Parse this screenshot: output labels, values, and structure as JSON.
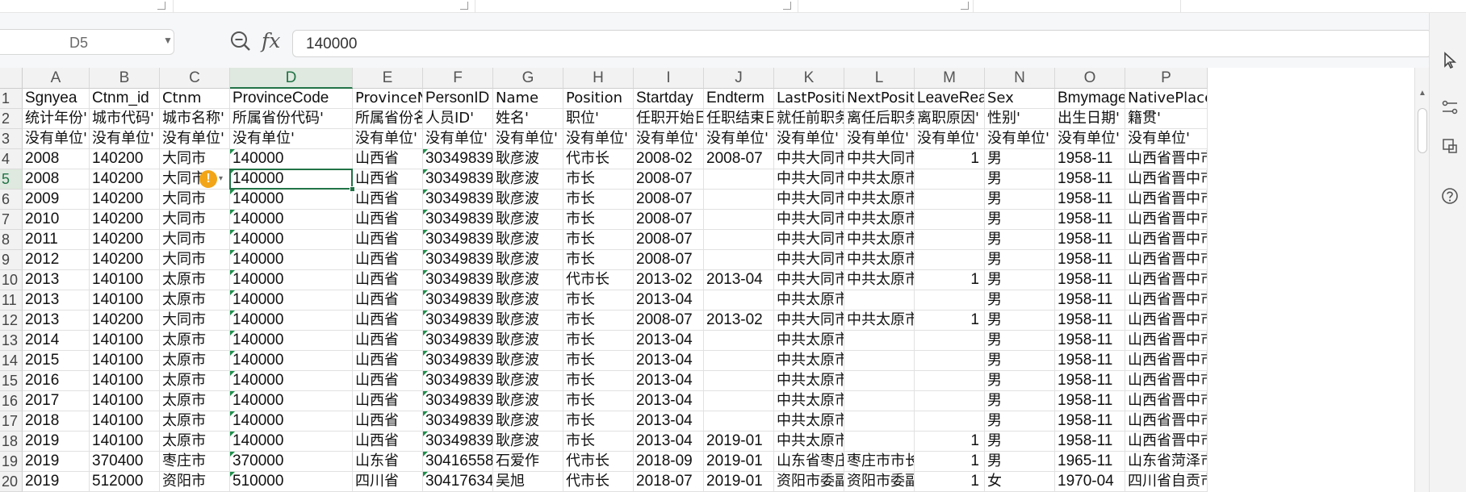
{
  "namebox": {
    "value": "D5"
  },
  "formula": {
    "value": "140000"
  },
  "columns": [
    "A",
    "B",
    "C",
    "D",
    "E",
    "F",
    "G",
    "H",
    "I",
    "J",
    "K",
    "L",
    "M",
    "N",
    "O",
    "P"
  ],
  "active_column": "D",
  "row_numbers": [
    "1",
    "2",
    "3",
    "4",
    "5",
    "6",
    "7",
    "8",
    "9",
    "10",
    "11",
    "12",
    "13",
    "14",
    "15",
    "16",
    "17",
    "18",
    "19",
    "20"
  ],
  "active_row": "5",
  "rows": [
    [
      "Sgnyea",
      "Ctnm_id",
      "Ctnm",
      "ProvinceCode",
      "ProvinceNa",
      "PersonID",
      "Name",
      "Position",
      "Startday",
      "Endterm",
      "LastPositio",
      "NextPositio",
      "LeaveReas",
      "Sex",
      "Bmymager",
      "NativePlace"
    ],
    [
      "统计年份'",
      "城市代码'",
      "城市名称'",
      "所属省份代码'",
      "所属省份名",
      "人员ID'",
      "姓名'",
      "职位'",
      "任职开始日",
      "任职结束日",
      "就任前职务",
      "离任后职务",
      "离职原因'",
      "性别'",
      "出生日期'",
      "籍贯'"
    ],
    [
      "没有单位'",
      "没有单位'",
      "没有单位'",
      "没有单位'",
      "没有单位'",
      "没有单位'",
      "没有单位'",
      "没有单位'",
      "没有单位'",
      "没有单位'",
      "没有单位'",
      "没有单位'",
      "没有单位'",
      "没有单位'",
      "没有单位'",
      "没有单位'"
    ],
    [
      "2008",
      "140200",
      "大同市",
      "140000",
      "山西省",
      "30349839",
      "耿彦波",
      "代市长",
      "2008-02",
      "2008-07",
      "中共大同市",
      "中共大同市",
      "1",
      "男",
      "1958-11",
      "山西省晋中市科"
    ],
    [
      "2008",
      "140200",
      "大同市",
      "140000",
      "山西省",
      "30349839",
      "耿彦波",
      "市长",
      "2008-07",
      "",
      "中共大同市",
      "中共太原市委副书记、",
      "",
      "男",
      "1958-11",
      "山西省晋中市科"
    ],
    [
      "2009",
      "140200",
      "大同市",
      "140000",
      "山西省",
      "30349839",
      "耿彦波",
      "市长",
      "2008-07",
      "",
      "中共大同市",
      "中共太原市委副书记、",
      "",
      "男",
      "1958-11",
      "山西省晋中市科"
    ],
    [
      "2010",
      "140200",
      "大同市",
      "140000",
      "山西省",
      "30349839",
      "耿彦波",
      "市长",
      "2008-07",
      "",
      "中共大同市",
      "中共太原市委副书记、",
      "",
      "男",
      "1958-11",
      "山西省晋中市科"
    ],
    [
      "2011",
      "140200",
      "大同市",
      "140000",
      "山西省",
      "30349839",
      "耿彦波",
      "市长",
      "2008-07",
      "",
      "中共大同市",
      "中共太原市委副书记、",
      "",
      "男",
      "1958-11",
      "山西省晋中市科"
    ],
    [
      "2012",
      "140200",
      "大同市",
      "140000",
      "山西省",
      "30349839",
      "耿彦波",
      "市长",
      "2008-07",
      "",
      "中共大同市",
      "中共太原市委副书记、",
      "",
      "男",
      "1958-11",
      "山西省晋中市科"
    ],
    [
      "2013",
      "140100",
      "太原市",
      "140000",
      "山西省",
      "30349839",
      "耿彦波",
      "代市长",
      "2013-02",
      "2013-04",
      "中共大同市",
      "中共太原市",
      "1",
      "男",
      "1958-11",
      "山西省晋中市科"
    ],
    [
      "2013",
      "140100",
      "太原市",
      "140000",
      "山西省",
      "30349839",
      "耿彦波",
      "市长",
      "2013-04",
      "",
      "中共太原市委副书记、市政府副市",
      "",
      "",
      "男",
      "1958-11",
      "山西省晋中市科"
    ],
    [
      "2013",
      "140200",
      "大同市",
      "140000",
      "山西省",
      "30349839",
      "耿彦波",
      "市长",
      "2008-07",
      "2013-02",
      "中共大同市",
      "中共太原市",
      "1",
      "男",
      "1958-11",
      "山西省晋中市科"
    ],
    [
      "2014",
      "140100",
      "太原市",
      "140000",
      "山西省",
      "30349839",
      "耿彦波",
      "市长",
      "2013-04",
      "",
      "中共太原市委副书记、市政府副市",
      "",
      "",
      "男",
      "1958-11",
      "山西省晋中市科"
    ],
    [
      "2015",
      "140100",
      "太原市",
      "140000",
      "山西省",
      "30349839",
      "耿彦波",
      "市长",
      "2013-04",
      "",
      "中共太原市委副书记、市政府副市",
      "",
      "",
      "男",
      "1958-11",
      "山西省晋中市科"
    ],
    [
      "2016",
      "140100",
      "太原市",
      "140000",
      "山西省",
      "30349839",
      "耿彦波",
      "市长",
      "2013-04",
      "",
      "中共太原市委副书记、市政府副市",
      "",
      "",
      "男",
      "1958-11",
      "山西省晋中市科"
    ],
    [
      "2017",
      "140100",
      "太原市",
      "140000",
      "山西省",
      "30349839",
      "耿彦波",
      "市长",
      "2013-04",
      "",
      "中共太原市委副书记、市政府副市",
      "",
      "",
      "男",
      "1958-11",
      "山西省晋中市科"
    ],
    [
      "2018",
      "140100",
      "太原市",
      "140000",
      "山西省",
      "30349839",
      "耿彦波",
      "市长",
      "2013-04",
      "",
      "中共太原市委副书记、市政府副市",
      "",
      "",
      "男",
      "1958-11",
      "山西省晋中市科"
    ],
    [
      "2019",
      "140100",
      "太原市",
      "140000",
      "山西省",
      "30349839",
      "耿彦波",
      "市长",
      "2013-04",
      "2019-01",
      "中共太原市委副书记、",
      "",
      "1",
      "男",
      "1958-11",
      "山西省晋中市科"
    ],
    [
      "2019",
      "370400",
      "枣庄市",
      "370000",
      "山东省",
      "30416558",
      "石爱作",
      "代市长",
      "2018-09",
      "2019-01",
      "山东省枣庄",
      "枣庄市市长",
      "1",
      "男",
      "1965-11",
      "山东省菏泽市郓"
    ],
    [
      "2019",
      "512000",
      "资阳市",
      "510000",
      "四川省",
      "30417634",
      "吴旭",
      "代市长",
      "2018-07",
      "2019-01",
      "资阳市委副",
      "资阳市委副",
      "1",
      "女",
      "1970-04",
      "四川省自贡市"
    ]
  ],
  "warning_symbol": "!",
  "icons": {
    "zoom": "zoom-formula-icon",
    "fx": "fx",
    "side": [
      "cursor-icon",
      "connector-icon",
      "shape-icon",
      "help-icon"
    ]
  },
  "accent_color": "#217346"
}
